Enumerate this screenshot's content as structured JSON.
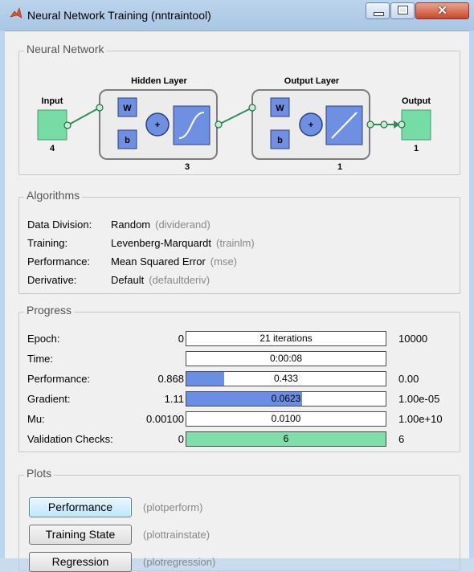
{
  "window": {
    "title": "Neural Network Training (nntraintool)",
    "close_glyph": "✕"
  },
  "network": {
    "section_title": "Neural Network",
    "input_label": "Input",
    "input_size": "4",
    "hidden_title": "Hidden Layer",
    "hidden_size": "3",
    "output_title": "Output Layer",
    "output_size": "1",
    "output_label": "Output",
    "weight_symbol": "W",
    "bias_symbol": "b",
    "sum_symbol": "+"
  },
  "algorithms": {
    "section_title": "Algorithms",
    "rows": [
      {
        "label": "Data Division:",
        "value": "Random",
        "function": "(dividerand)"
      },
      {
        "label": "Training:",
        "value": "Levenberg-Marquardt",
        "function": "(trainlm)"
      },
      {
        "label": "Performance:",
        "value": "Mean Squared Error",
        "function": "(mse)"
      },
      {
        "label": "Derivative:",
        "value": "Default",
        "function": "(defaultderiv)"
      }
    ]
  },
  "progress": {
    "section_title": "Progress",
    "rows": [
      {
        "label": "Epoch:",
        "min": "0",
        "current": "21 iterations",
        "max": "10000",
        "fill": 0.0,
        "fill_color": "#6a8ee6"
      },
      {
        "label": "Time:",
        "min": "",
        "current": "0:00:08",
        "max": "",
        "fill": 0.0,
        "fill_color": "#6a8ee6"
      },
      {
        "label": "Performance:",
        "min": "0.868",
        "current": "0.433",
        "max": "0.00",
        "fill": 0.19,
        "fill_color": "#6a8ee6"
      },
      {
        "label": "Gradient:",
        "min": "1.11",
        "current": "0.0623",
        "max": "1.00e-05",
        "fill": 0.58,
        "fill_color": "#6a8ee6"
      },
      {
        "label": "Mu:",
        "min": "0.00100",
        "current": "0.0100",
        "max": "1.00e+10",
        "fill": 0.0,
        "fill_color": "#6a8ee6"
      },
      {
        "label": "Validation Checks:",
        "min": "0",
        "current": "6",
        "max": "6",
        "fill": 1.0,
        "fill_color": "#7ee0a8"
      }
    ]
  },
  "plots": {
    "section_title": "Plots",
    "buttons": [
      {
        "label": "Performance",
        "command": "(plotperform)"
      },
      {
        "label": "Training State",
        "command": "(plottrainstate)"
      },
      {
        "label": "Regression",
        "command": "(plotregression)"
      }
    ]
  },
  "colors": {
    "node_green": "#76dca6",
    "weight_blue": "#6f8fe2",
    "progress_blue": "#6a8ee6",
    "validation_green": "#7ee0a8"
  }
}
